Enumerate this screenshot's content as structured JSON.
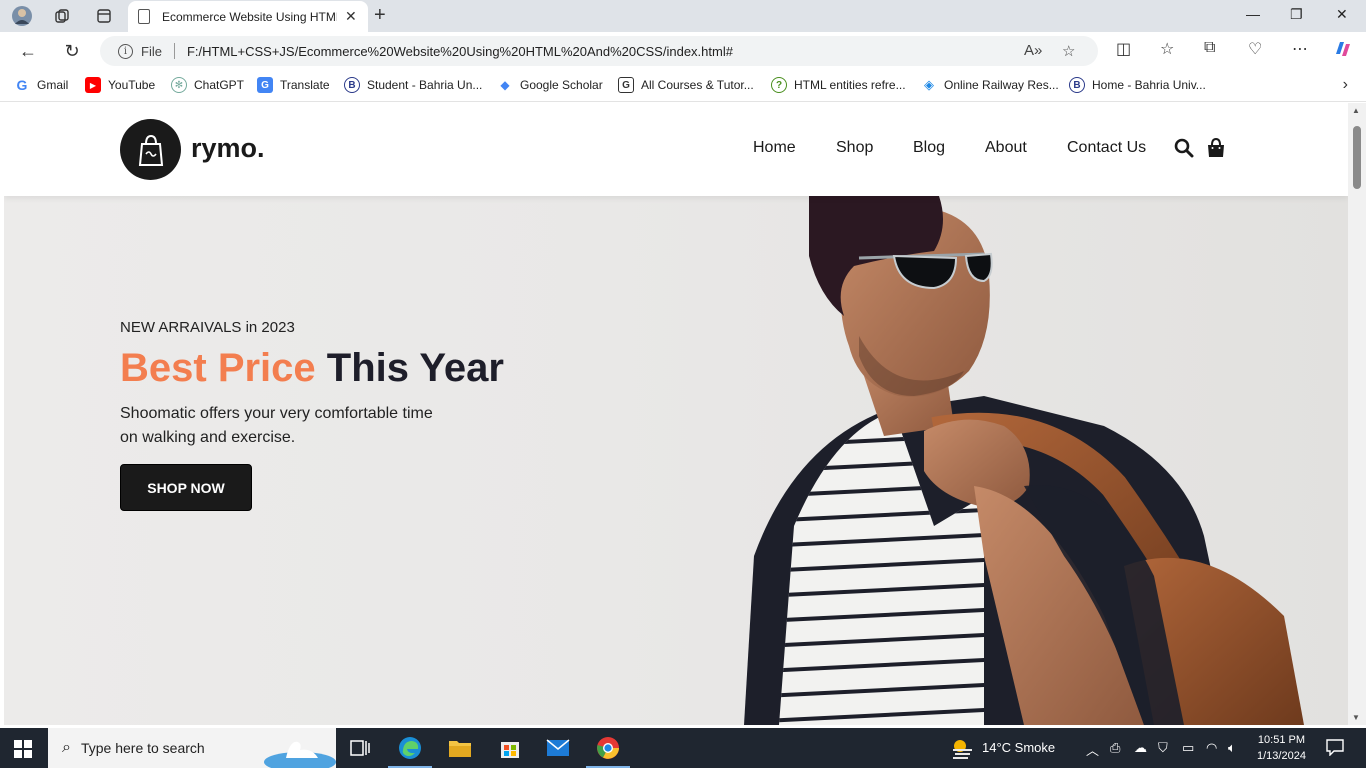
{
  "browser": {
    "tab_title": "Ecommerce Website Using HTML",
    "address": {
      "scheme_label": "File",
      "url": "F:/HTML+CSS+JS/Ecommerce%20Website%20Using%20HTML%20And%20CSS/index.html#"
    }
  },
  "bookmarks": [
    {
      "label": "Gmail",
      "icon": "google-icon",
      "color": "#4285f4"
    },
    {
      "label": "YouTube",
      "icon": "youtube-icon",
      "color": "#ff0000"
    },
    {
      "label": "ChatGPT",
      "icon": "chatgpt-icon",
      "color": "#74aa9c"
    },
    {
      "label": "Translate",
      "icon": "translate-icon",
      "color": "#4285f4"
    },
    {
      "label": "Student - Bahria Un...",
      "icon": "bahria-icon",
      "color": "#2b3a8a"
    },
    {
      "label": "Google Scholar",
      "icon": "scholar-icon",
      "color": "#4285f4"
    },
    {
      "label": "All Courses & Tutor...",
      "icon": "courses-icon",
      "color": "#333333"
    },
    {
      "label": "HTML entities refre...",
      "icon": "question-icon",
      "color": "#4a8f1f"
    },
    {
      "label": "Online Railway Res...",
      "icon": "railway-icon",
      "color": "#1e88e5"
    },
    {
      "label": "Home - Bahria Univ...",
      "icon": "bahria-icon",
      "color": "#2b3a8a"
    }
  ],
  "site": {
    "brand": "rymo.",
    "nav": [
      "Home",
      "Shop",
      "Blog",
      "About",
      "Contact Us"
    ],
    "hero": {
      "kicker": "NEW ARRAIVALS in 2023",
      "title_accent": "Best Price",
      "title_rest": "This Year",
      "desc": "Shoomatic offers your very comfortable time on walking and exercise.",
      "button": "SHOP NOW"
    },
    "colors": {
      "accent": "#f37e4f",
      "dark": "#1a1a1a"
    }
  },
  "taskbar": {
    "search_placeholder": "Type here to search",
    "weather": "14°C  Smoke",
    "time": "10:51 PM",
    "date": "1/13/2024"
  }
}
